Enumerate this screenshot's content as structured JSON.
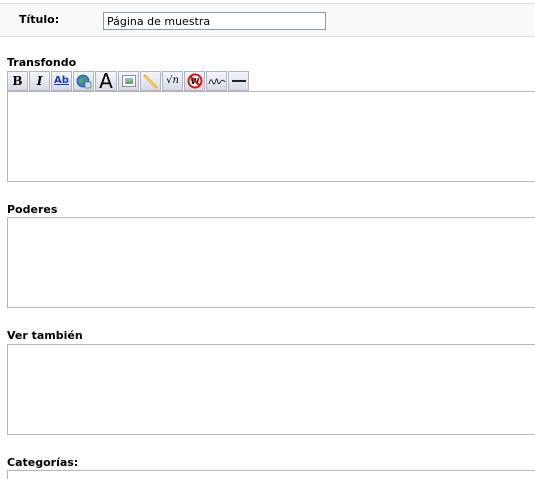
{
  "form": {
    "title_label": "Título:",
    "title_value": "Página de muestra"
  },
  "sections": [
    {
      "label": "Transfondo"
    },
    {
      "label": "Poderes"
    },
    {
      "label": "Ver también"
    },
    {
      "label": "Categorías:"
    }
  ],
  "toolbar": {
    "buttons": [
      {
        "icon": "bold-icon",
        "glyph": "B"
      },
      {
        "icon": "italic-icon",
        "glyph": "I"
      },
      {
        "icon": "internal-link-icon",
        "glyph": "Ab"
      },
      {
        "icon": "external-link-icon"
      },
      {
        "icon": "headline-icon",
        "glyph": "A"
      },
      {
        "icon": "embedded-image-icon"
      },
      {
        "icon": "media-file-icon"
      },
      {
        "icon": "math-formula-icon",
        "glyph": "√n"
      },
      {
        "icon": "nowiki-icon"
      },
      {
        "icon": "signature-icon"
      },
      {
        "icon": "horizontal-line-icon"
      }
    ]
  },
  "colors": {
    "input_border": "#7f9db9",
    "textarea_border": "#b5b5b5",
    "title_row_bg": "#f9f9f9"
  }
}
